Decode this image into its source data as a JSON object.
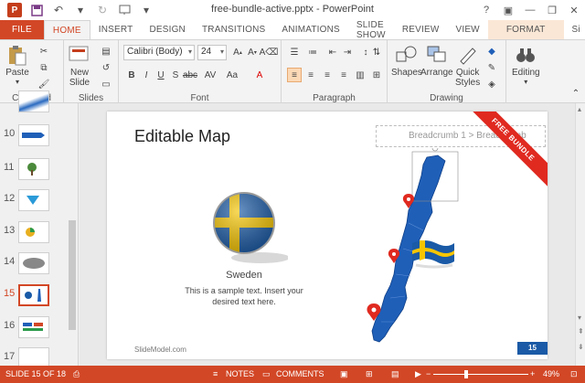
{
  "window": {
    "title": "free-bundle-active.pptx - PowerPoint"
  },
  "tabs": [
    {
      "label": "FILE"
    },
    {
      "label": "HOME"
    },
    {
      "label": "INSERT"
    },
    {
      "label": "DESIGN"
    },
    {
      "label": "TRANSITIONS"
    },
    {
      "label": "ANIMATIONS"
    },
    {
      "label": "SLIDE SHOW"
    },
    {
      "label": "REVIEW"
    },
    {
      "label": "VIEW"
    },
    {
      "label": "FORMAT"
    },
    {
      "label": "Si"
    }
  ],
  "ribbon": {
    "clipboard": {
      "label": "Clipboard",
      "paste": "Paste"
    },
    "slides": {
      "label": "Slides",
      "new_slide": "New",
      "new_slide2": "Slide"
    },
    "font": {
      "label": "Font",
      "font_name": "Calibri (Body)",
      "font_size": "24"
    },
    "paragraph": {
      "label": "Paragraph"
    },
    "drawing": {
      "label": "Drawing",
      "shapes": "Shapes",
      "arrange": "Arrange",
      "quick_styles": "Quick",
      "quick_styles2": "Styles"
    },
    "editing": {
      "label": "Editing"
    }
  },
  "slides": [
    {
      "num": "10"
    },
    {
      "num": "11"
    },
    {
      "num": "12"
    },
    {
      "num": "13"
    },
    {
      "num": "14"
    },
    {
      "num": "15",
      "selected": true
    },
    {
      "num": "16"
    },
    {
      "num": "17"
    }
  ],
  "slide": {
    "title": "Editable Map",
    "breadcrumb": "Breadcrumb 1 > Breadcrumb",
    "badge": "FREE BUNDLE",
    "country": "Sweden",
    "sample_text": "This is a sample text. Insert your desired text here.",
    "brand": "SlideModel.com",
    "page": "15"
  },
  "status": {
    "slide_count": "SLIDE 15 OF 18",
    "notes": "NOTES",
    "comments": "COMMENTS",
    "zoom": "49%"
  },
  "colors": {
    "accent": "#d24726",
    "map_blue": "#1f5fb8",
    "flag_blue": "#1a5aa6",
    "flag_yellow": "#f6c500",
    "badge_red": "#e02a20"
  }
}
